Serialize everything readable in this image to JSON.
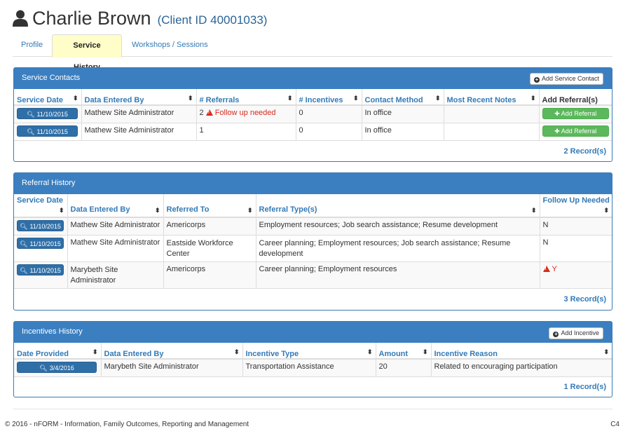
{
  "client": {
    "name": "Charlie Brown",
    "client_id_label": "(Client ID 40001033)"
  },
  "tabs": [
    {
      "label": "Profile"
    },
    {
      "label": "Service History",
      "active": true
    },
    {
      "label": "Workshops / Sessions"
    }
  ],
  "service_contacts": {
    "title": "Service Contacts",
    "add_button": "Add Service Contact",
    "columns": [
      "Service Date",
      "Data Entered By",
      "# Referrals",
      "# Incentives",
      "Contact Method",
      "Most Recent Notes",
      "Add Referral(s)"
    ],
    "rows": [
      {
        "date": "11/10/2015",
        "entered_by": "Mathew Site Administrator",
        "referrals": "2",
        "referral_note": "Follow up needed",
        "incentives": "0",
        "method": "In office",
        "notes": "",
        "action": "Add Referral"
      },
      {
        "date": "11/10/2015",
        "entered_by": "Mathew Site Administrator",
        "referrals": "1",
        "referral_note": "",
        "incentives": "0",
        "method": "In office",
        "notes": "",
        "action": "Add Referral"
      }
    ],
    "records": "2 Record(s)"
  },
  "referral_history": {
    "title": "Referral History",
    "columns": [
      "Service Date",
      "Data Entered By",
      "Referred To",
      "Referral Type(s)",
      "Follow Up Needed"
    ],
    "rows": [
      {
        "date": "11/10/2015",
        "entered_by": "Mathew Site Administrator",
        "referred_to": "Americorps",
        "types": "Employment resources; Job search assistance; Resume development",
        "follow_up": "N",
        "warn": false
      },
      {
        "date": "11/10/2015",
        "entered_by": "Mathew Site Administrator",
        "referred_to": "Eastside Workforce Center",
        "types": "Career planning; Employment resources; Job search assistance; Resume development",
        "follow_up": "N",
        "warn": false
      },
      {
        "date": "11/10/2015",
        "entered_by": "Marybeth Site Administrator",
        "referred_to": "Americorps",
        "types": "Career planning; Employment resources",
        "follow_up": "Y",
        "warn": true
      }
    ],
    "records": "3 Record(s)"
  },
  "incentives_history": {
    "title": "Incentives History",
    "add_button": "Add Incentive",
    "columns": [
      "Date Provided",
      "Data Entered By",
      "Incentive Type",
      "Amount",
      "Incentive Reason"
    ],
    "rows": [
      {
        "date": "3/4/2016",
        "entered_by": "Marybeth Site Administrator",
        "type": "Transportation Assistance",
        "amount": "20",
        "reason": "Related to encouraging participation"
      }
    ],
    "records": "1 Record(s)"
  },
  "footer": {
    "text": "© 2016 - nFORM - Information, Family Outcomes, Reporting and Management",
    "code": "C4"
  },
  "colors": {
    "panel_header": "#3b7fc0",
    "link": "#337ab7",
    "active_tab": "#fffdc8",
    "success": "#5cb85c",
    "danger": "#d9291c"
  }
}
